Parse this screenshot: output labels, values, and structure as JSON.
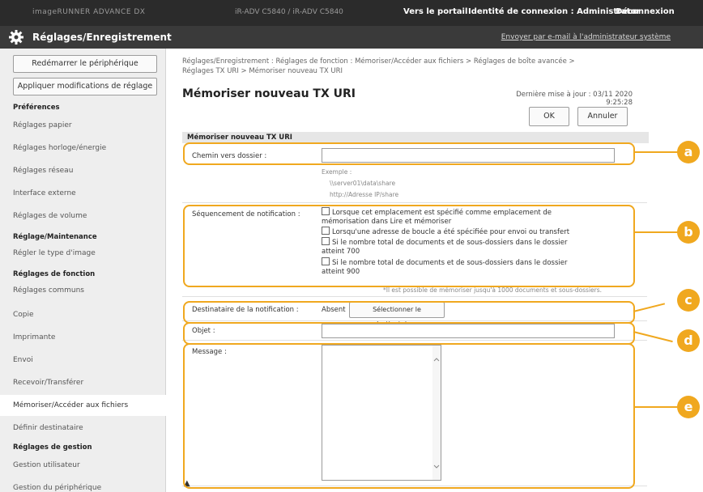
{
  "topbar": {
    "device_name": "imageRUNNER ADVANCE DX",
    "device_info": "iR-ADV C5840 / iR-ADV C5840",
    "portal_link": "Vers le portail",
    "login_label": "Identité de connexion : Administrator",
    "logout_link": "Déconnexion"
  },
  "titlebar": {
    "title": "Réglages/Enregistrement",
    "mail_link": "Envoyer par e-mail à l'administrateur système"
  },
  "sidebar": {
    "restart_button": "Redémarrer le périphérique",
    "apply_button": "Appliquer modifications de réglage",
    "group_prefs": "Préférences",
    "prefs_items": [
      "Réglages papier",
      "Réglages horloge/énergie",
      "Réglages réseau",
      "Interface externe",
      "Réglages de volume"
    ],
    "group_maint": "Réglage/Maintenance",
    "maint_items": [
      "Régler le type d'image"
    ],
    "group_func": "Réglages de fonction",
    "func_items": [
      "Réglages communs",
      "Copie",
      "Imprimante",
      "Envoi",
      "Recevoir/Transférer",
      "Mémoriser/Accéder aux fichiers",
      "Définir destinataire"
    ],
    "group_mgmt": "Réglages de gestion",
    "mgmt_items": [
      "Gestion utilisateur",
      "Gestion du périphérique"
    ]
  },
  "main": {
    "breadcrumb_line1": "Réglages/Enregistrement : Réglages de fonction : Mémoriser/Accéder aux fichiers > Réglages de boîte avancée >",
    "breadcrumb_line2": "Réglages TX URI > Mémoriser nouveau TX URI",
    "page_title": "Mémoriser nouveau TX URI",
    "last_update": "Dernière mise à jour : 03/11 2020 9:25:28",
    "ok_button": "OK",
    "cancel_button": "Annuler",
    "section_header": "Mémoriser nouveau TX URI",
    "folder_path_label": "Chemin vers dossier :",
    "folder_path_value": "",
    "example_label": "Exemple :",
    "example_1": "\\\\server01\\data\\share",
    "example_2": "http://Adresse IP/share",
    "notif_label": "Séquencement de notification :",
    "notif_options": [
      {
        "line1": "Lorsque cet emplacement est spécifié comme emplacement de",
        "line2": "mémorisation dans Lire et mémoriser"
      },
      {
        "line1": "Lorsqu'une adresse de boucle a été spécifiée pour envoi ou transfert",
        "line2": ""
      },
      {
        "line1": "Si le nombre total de documents et de sous-dossiers dans le dossier",
        "line2": "atteint 700"
      },
      {
        "line1": "Si le nombre total de documents et de sous-dossiers dans le dossier",
        "line2": "atteint 900"
      }
    ],
    "notif_note": "*Il est possible de mémoriser jusqu'à 1000 documents et sous-dossiers.",
    "recipient_label": "Destinataire de la notification :",
    "recipient_value": "Absent",
    "recipient_button": "Sélectionner le destinataire...",
    "subject_label": "Objet :",
    "subject_value": "",
    "message_label": "Message :",
    "message_value": "",
    "to_top": "▲"
  },
  "callouts": [
    "a",
    "b",
    "c",
    "d",
    "e"
  ],
  "colors": {
    "callout": "#f0a81f",
    "topbar": "#2b2b2b",
    "titlebar": "#3a3a3a",
    "sidebar": "#eeeeee"
  },
  "icons": {
    "settings": "gear-icon"
  }
}
